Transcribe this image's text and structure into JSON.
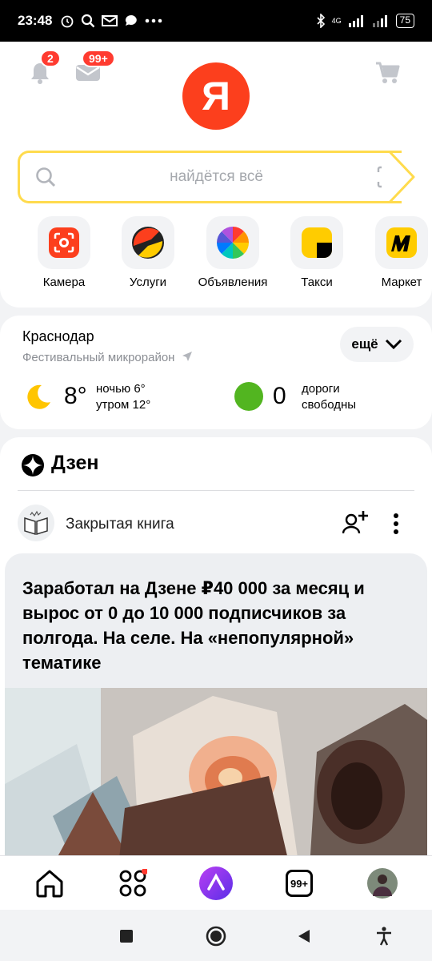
{
  "status_bar": {
    "time": "23:48",
    "left_icons": [
      "alarm-icon",
      "search-icon",
      "mail-icon",
      "chat-icon",
      "more-icon"
    ],
    "network": "4G",
    "battery": "75"
  },
  "header": {
    "notifications_badge": "2",
    "mail_badge": "99+",
    "logo_letter": "Я"
  },
  "search": {
    "placeholder": "найдётся всё"
  },
  "services": [
    {
      "label": "Камера"
    },
    {
      "label": "Услуги"
    },
    {
      "label": "Объявления"
    },
    {
      "label": "Такси"
    },
    {
      "label": "Маркет"
    }
  ],
  "weather": {
    "city": "Краснодар",
    "district": "Фестивальный микрорайон",
    "more_label": "ещё",
    "temperature": "8°",
    "night": "ночью 6°",
    "morning": "утром 12°",
    "traffic_score": "0",
    "traffic_line1": "дороги",
    "traffic_line2": "свободны"
  },
  "dzen": {
    "title": "Дзен",
    "channel_name": "Закрытая книга",
    "article_title": "Заработал на Дзене ₽40 000 за месяц и вырос от 0 до 10 000 подписчиков за полгода. На селе. На «непопулярной» тематике"
  },
  "bottom_nav": {
    "tabs_badge": "99+"
  },
  "colors": {
    "brand_red": "#fc3f1d",
    "search_yellow": "#ffdb4d",
    "alice_purple": "#8a3ffc",
    "traffic_green": "#52b520"
  }
}
